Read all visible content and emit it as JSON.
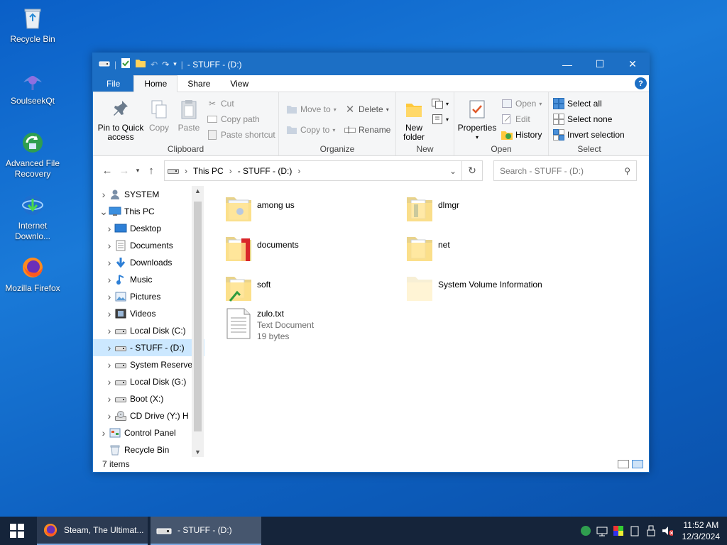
{
  "desktop": {
    "icons": [
      {
        "label": "Recycle Bin",
        "icon": "recycle-bin-icon"
      },
      {
        "label": "SoulseekQt",
        "icon": "soulseek-icon"
      },
      {
        "label": "Advanced File Recovery",
        "icon": "file-recovery-icon"
      },
      {
        "label": "Internet Downlo...",
        "icon": "internet-download-manager-icon"
      },
      {
        "label": "Mozilla Firefox",
        "icon": "firefox-icon"
      }
    ]
  },
  "window": {
    "title": "- STUFF - (D:)",
    "tabs": {
      "file": "File",
      "home": "Home",
      "share": "Share",
      "view": "View"
    },
    "help": "?",
    "controls": {
      "minimize": "—",
      "maximize": "☐",
      "close": "✕"
    }
  },
  "ribbon": {
    "clipboard": {
      "label": "Clipboard",
      "pin": "Pin to Quick access",
      "copy": "Copy",
      "paste": "Paste",
      "cut": "Cut",
      "copy_path": "Copy path",
      "paste_shortcut": "Paste shortcut"
    },
    "organize": {
      "label": "Organize",
      "move_to": "Move to",
      "copy_to": "Copy to",
      "delete": "Delete",
      "rename": "Rename"
    },
    "new": {
      "label": "New",
      "new_folder": "New folder"
    },
    "open": {
      "label": "Open",
      "properties": "Properties",
      "open": "Open",
      "edit": "Edit",
      "history": "History"
    },
    "select": {
      "label": "Select",
      "select_all": "Select all",
      "select_none": "Select none",
      "invert_selection": "Invert selection"
    }
  },
  "address": {
    "crumbs": [
      "This PC",
      "- STUFF - (D:)"
    ],
    "search_placeholder": "Search - STUFF - (D:)"
  },
  "navpane": {
    "items": [
      {
        "label": "SYSTEM",
        "indent": 0,
        "expanded": false,
        "icon": "user-folder-icon"
      },
      {
        "label": "This PC",
        "indent": 0,
        "expanded": true,
        "icon": "computer-icon"
      },
      {
        "label": "Desktop",
        "indent": 1,
        "expanded": false,
        "icon": "desktop-folder-icon"
      },
      {
        "label": "Documents",
        "indent": 1,
        "expanded": false,
        "icon": "documents-folder-icon"
      },
      {
        "label": "Downloads",
        "indent": 1,
        "expanded": false,
        "icon": "downloads-folder-icon"
      },
      {
        "label": "Music",
        "indent": 1,
        "expanded": false,
        "icon": "music-folder-icon"
      },
      {
        "label": "Pictures",
        "indent": 1,
        "expanded": false,
        "icon": "pictures-folder-icon"
      },
      {
        "label": "Videos",
        "indent": 1,
        "expanded": false,
        "icon": "videos-folder-icon"
      },
      {
        "label": "Local Disk (C:)",
        "indent": 1,
        "expanded": false,
        "icon": "drive-icon"
      },
      {
        "label": "- STUFF - (D:)",
        "indent": 1,
        "expanded": false,
        "icon": "drive-icon",
        "selected": true
      },
      {
        "label": "System Reserve",
        "indent": 1,
        "expanded": false,
        "icon": "drive-icon"
      },
      {
        "label": "Local Disk (G:)",
        "indent": 1,
        "expanded": false,
        "icon": "drive-icon"
      },
      {
        "label": "Boot (X:)",
        "indent": 1,
        "expanded": false,
        "icon": "drive-icon"
      },
      {
        "label": "CD Drive (Y:) H",
        "indent": 1,
        "expanded": false,
        "icon": "cd-drive-icon"
      },
      {
        "label": "Control Panel",
        "indent": 0,
        "expanded": false,
        "icon": "control-panel-icon"
      },
      {
        "label": "Recycle Bin",
        "indent": 0,
        "expanded": false,
        "icon": "recycle-bin-icon",
        "nochev": true
      }
    ]
  },
  "files": [
    {
      "name": "among us",
      "type": "folder"
    },
    {
      "name": "dlmgr",
      "type": "folder"
    },
    {
      "name": "documents",
      "type": "folder"
    },
    {
      "name": "net",
      "type": "folder"
    },
    {
      "name": "soft",
      "type": "folder"
    },
    {
      "name": "System Volume Information",
      "type": "folder-hidden"
    },
    {
      "name": "zulo.txt",
      "type": "text",
      "kind": "Text Document",
      "size": "19 bytes"
    }
  ],
  "status": {
    "count": "7 items"
  },
  "taskbar": {
    "apps": [
      {
        "label": "Steam, The Ultimat...",
        "icon": "firefox-icon",
        "active": false
      },
      {
        "label": "- STUFF - (D:)",
        "icon": "drive-icon",
        "active": true
      }
    ],
    "time": "11:52 AM",
    "date": "12/3/2024"
  },
  "colors": {
    "accent": "#1c6fc5",
    "selection": "#cce8ff",
    "taskbar": "#15243a"
  }
}
